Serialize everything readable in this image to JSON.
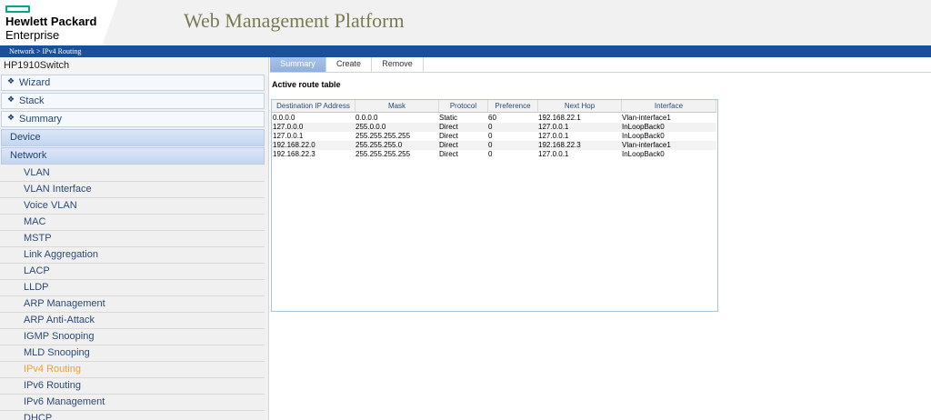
{
  "header": {
    "logo_line1": "Hewlett Packard",
    "logo_line2": "Enterprise",
    "title": "Web Management Platform",
    "breadcrumb": "Network > IPv4 Routing",
    "brand_color": "#01a982",
    "bar_color": "#1a4f9a"
  },
  "sidebar": {
    "device": "HP1910Switch",
    "groups": [
      "Wizard",
      "Stack",
      "Summary"
    ],
    "sections": [
      "Device",
      "Network"
    ],
    "items": [
      "VLAN",
      "VLAN Interface",
      "Voice VLAN",
      "MAC",
      "MSTP",
      "Link Aggregation",
      "LACP",
      "LLDP",
      "ARP Management",
      "ARP Anti-Attack",
      "IGMP Snooping",
      "MLD Snooping",
      "IPv4 Routing",
      "IPv6 Routing",
      "IPv6 Management",
      "DHCP"
    ],
    "active_item": "IPv4 Routing",
    "active_color": "#f0a030"
  },
  "tabs": [
    "Summary",
    "Create",
    "Remove"
  ],
  "active_tab": "Summary",
  "section_title": "Active route table",
  "table": {
    "columns": [
      "Destination IP Address",
      "Mask",
      "Protocol",
      "Preference",
      "Next Hop",
      "Interface"
    ],
    "rows": [
      [
        "0.0.0.0",
        "0.0.0.0",
        "Static",
        "60",
        "192.168.22.1",
        "Vlan-interface1"
      ],
      [
        "127.0.0.0",
        "255.0.0.0",
        "Direct",
        "0",
        "127.0.0.1",
        "InLoopBack0"
      ],
      [
        "127.0.0.1",
        "255.255.255.255",
        "Direct",
        "0",
        "127.0.0.1",
        "InLoopBack0"
      ],
      [
        "192.168.22.0",
        "255.255.255.0",
        "Direct",
        "0",
        "192.168.22.3",
        "Vlan-interface1"
      ],
      [
        "192.168.22.3",
        "255.255.255.255",
        "Direct",
        "0",
        "127.0.0.1",
        "InLoopBack0"
      ]
    ]
  }
}
